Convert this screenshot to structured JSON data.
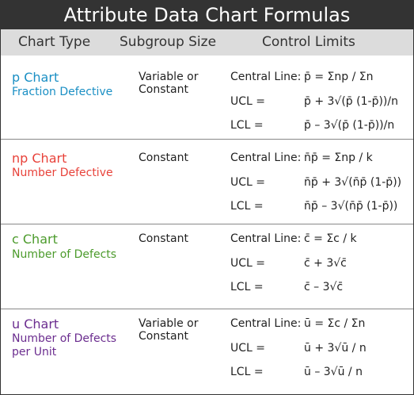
{
  "title": "Attribute Data Chart Formulas",
  "headers": {
    "chart_type": "Chart Type",
    "subgroup_size": "Subgroup Size",
    "control_limits": "Control Limits"
  },
  "colors": {
    "p": "#1a8fc4",
    "np": "#e8423a",
    "c": "#4c9b2c",
    "u": "#6b2d8f",
    "title_bg": "#333333",
    "header_bg": "#dcdcdc"
  },
  "sections": [
    {
      "name": "p Chart",
      "description": "Fraction Defective",
      "subgroup": "Variable or Constant",
      "central_label": "Central Line:",
      "central": "p̄ = Σnp / Σn",
      "ucl_label": "UCL =",
      "ucl": "p̄ + 3√(p̄ (1-p̄))/n",
      "lcl_label": "LCL =",
      "lcl": "p̄ – 3√(p̄ (1-p̄))/n"
    },
    {
      "name": "np Chart",
      "description": "Number Defective",
      "subgroup": "Constant",
      "central_label": "Central Line:",
      "central": "n̄p̄ = Σnp / k",
      "ucl_label": "UCL =",
      "ucl": "n̄p̄ + 3√(n̄p̄ (1-p̄))",
      "lcl_label": "LCL =",
      "lcl": "n̄p̄ – 3√(n̄p̄ (1-p̄))"
    },
    {
      "name": "c Chart",
      "description": "Number of Defects",
      "subgroup": "Constant",
      "central_label": "Central Line:",
      "central": "c̄ = Σc / k",
      "ucl_label": "UCL =",
      "ucl": "c̄ + 3√c̄",
      "lcl_label": "LCL =",
      "lcl": "c̄ – 3√c̄"
    },
    {
      "name": "u Chart",
      "description": "Number of Defects per Unit",
      "subgroup": "Variable or Constant",
      "central_label": "Central Line:",
      "central": "ū = Σc / Σn",
      "ucl_label": "UCL =",
      "ucl": "ū + 3√ū / n",
      "lcl_label": "LCL =",
      "lcl": "ū – 3√ū / n"
    }
  ]
}
